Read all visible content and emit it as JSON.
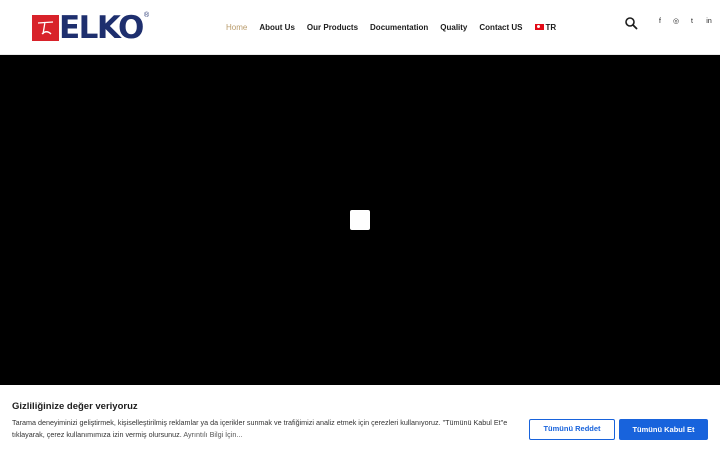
{
  "logo": {
    "text": "ELKO",
    "reg": "®"
  },
  "nav": {
    "items": [
      {
        "label": "Home",
        "active": true
      },
      {
        "label": "About Us"
      },
      {
        "label": "Our Products"
      },
      {
        "label": "Documentation"
      },
      {
        "label": "Quality"
      },
      {
        "label": "Contact US"
      }
    ],
    "language": "TR"
  },
  "header": {
    "icons": [
      "search-icon",
      "facebook-icon",
      "instagram-icon",
      "twitter-icon",
      "linkedin-icon"
    ],
    "social": {
      "facebook": "f",
      "instagram": "◎",
      "twitter": "t",
      "linkedin": "in"
    }
  },
  "cookie": {
    "title": "Gizliliğinize değer veriyoruz",
    "text": "Tarama deneyiminizi geliştirmek, kişiselleştirilmiş reklamlar ya da içerikler sunmak ve trafiğimizi analiz etmek için çerezleri kullanıyoruz. \"Tümünü Kabul Et\"e tıklayarak, çerez kullanımımıza izin vermiş olursunuz.",
    "link": "Ayrıntılı Bilgi İçin...",
    "reject_label": "Tümünü Reddet",
    "accept_label": "Tümünü Kabul Et"
  },
  "colors": {
    "brand_red": "#d8222a",
    "brand_navy": "#1e2f6e",
    "nav_active": "#b99b6b",
    "button_blue": "#1863dc"
  }
}
